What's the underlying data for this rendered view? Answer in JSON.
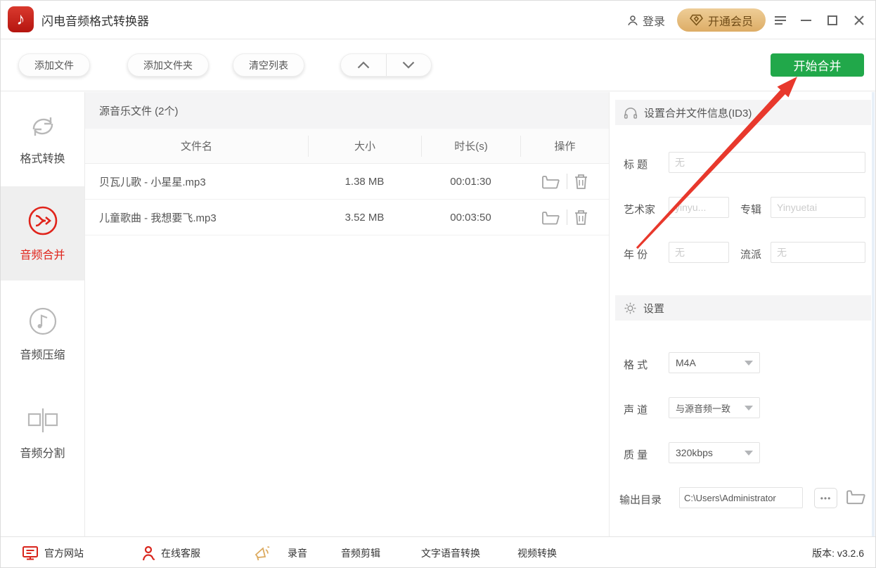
{
  "app": {
    "title": "闪电音频格式转换器"
  },
  "titlebar": {
    "login_label": "登录",
    "vip_label": "开通会员"
  },
  "toolbar": {
    "add_file": "添加文件",
    "add_folder": "添加文件夹",
    "clear_list": "清空列表",
    "start_merge": "开始合并"
  },
  "sidebar": {
    "items": [
      {
        "label": "格式转换"
      },
      {
        "label": "音频合并"
      },
      {
        "label": "音频压缩"
      },
      {
        "label": "音频分割"
      }
    ]
  },
  "filelist": {
    "title": "源音乐文件 (2个)",
    "columns": {
      "name": "文件名",
      "size": "大小",
      "duration": "时长(s)",
      "ops": "操作"
    },
    "rows": [
      {
        "name": "贝瓦儿歌 - 小星星.mp3",
        "size": "1.38 MB",
        "duration": "00:01:30"
      },
      {
        "name": "儿童歌曲 - 我想要飞.mp3",
        "size": "3.52 MB",
        "duration": "00:03:50"
      }
    ]
  },
  "id3": {
    "header": "设置合并文件信息(ID3)",
    "title_label": "标 题",
    "title_placeholder": "无",
    "artist_label": "艺术家",
    "artist_placeholder": "yinyu...",
    "album_label": "专辑",
    "album_placeholder": "Yinyuetai",
    "year_label": "年 份",
    "year_placeholder": "无",
    "genre_label": "流派",
    "genre_placeholder": "无"
  },
  "settings": {
    "header": "设置",
    "format_label": "格 式",
    "format_value": "M4A",
    "channel_label": "声 道",
    "channel_value": "与源音频一致",
    "quality_label": "质 量",
    "quality_value": "320kbps",
    "output_label": "输出目录",
    "output_value": "C:\\Users\\Administrator",
    "browse_dots": "•••"
  },
  "footer": {
    "official_site": "官方网站",
    "online_service": "在线客服",
    "record": "录音",
    "audio_edit": "音频剪辑",
    "tts": "文字语音转换",
    "video_convert": "视频转换",
    "version": "版本: v3.2.6"
  },
  "colors": {
    "accent_green": "#21a84a",
    "accent_red": "#e0241b",
    "vip_gold_bg": "#e4b876",
    "vip_gold_text": "#6e4a16"
  }
}
